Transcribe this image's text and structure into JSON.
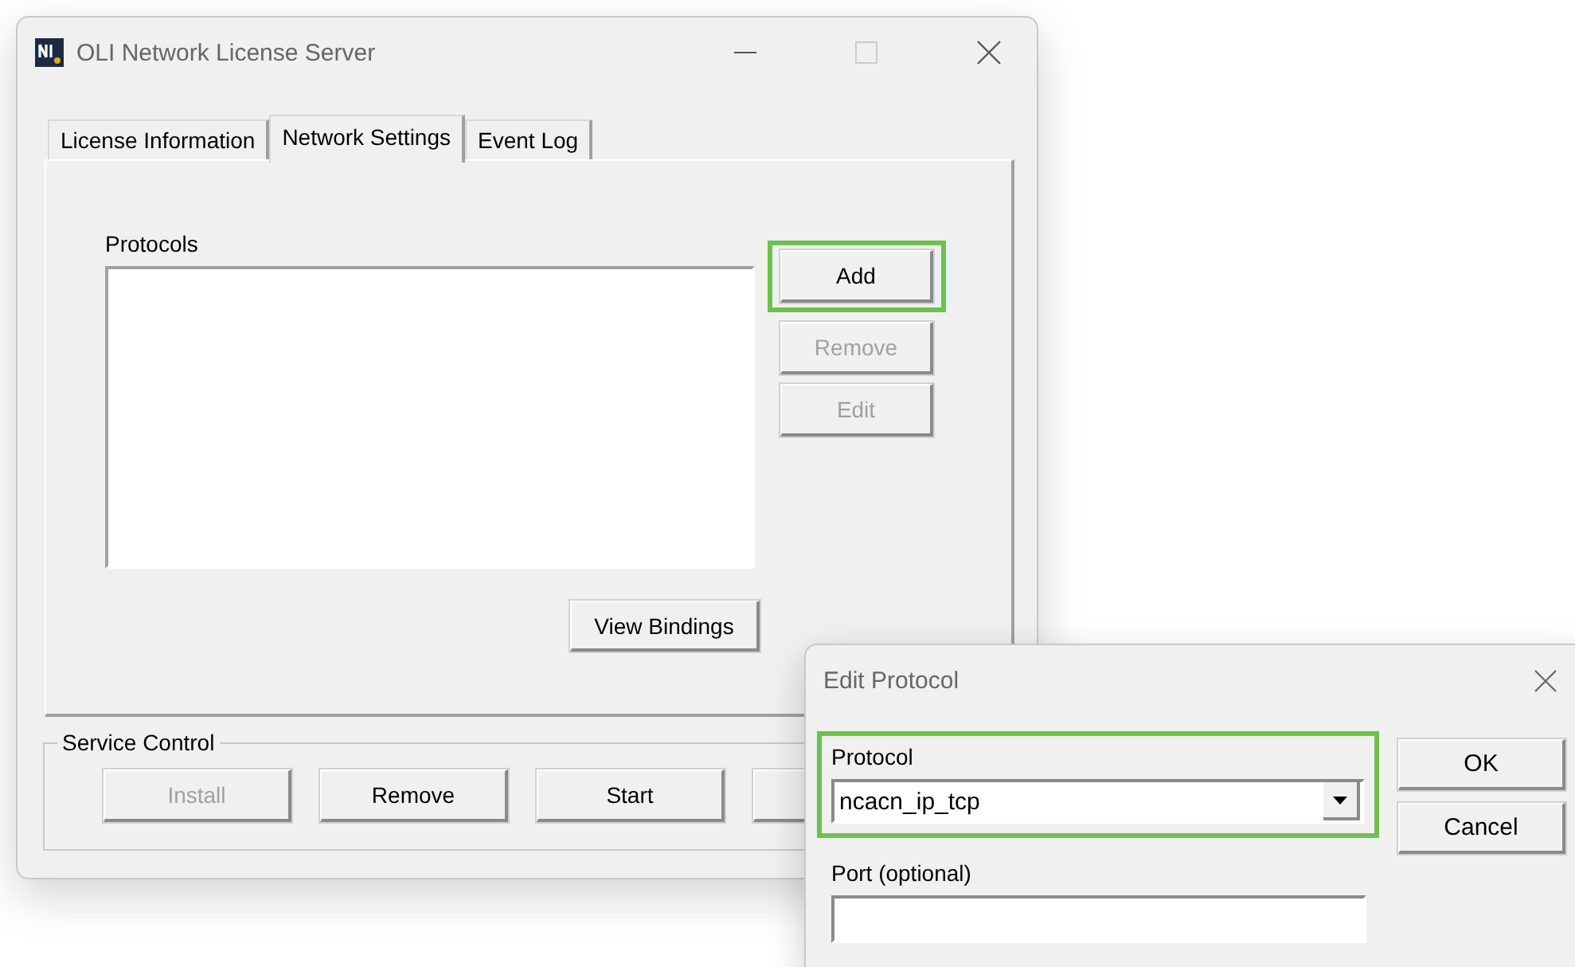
{
  "window": {
    "title": "OLI Network License Server"
  },
  "tabs": [
    {
      "label": "License Information",
      "selected": false
    },
    {
      "label": "Network Settings",
      "selected": true
    },
    {
      "label": "Event Log",
      "selected": false
    }
  ],
  "protocols": {
    "label": "Protocols"
  },
  "side_buttons": [
    {
      "label": "Add",
      "disabled": false,
      "highlighted": true
    },
    {
      "label": "Remove",
      "disabled": true,
      "highlighted": false
    },
    {
      "label": "Edit",
      "disabled": true,
      "highlighted": false
    }
  ],
  "view_bindings": {
    "label": "View Bindings"
  },
  "service_control": {
    "label": "Service Control",
    "buttons": [
      {
        "label": "Install",
        "disabled": true
      },
      {
        "label": "Remove",
        "disabled": false
      },
      {
        "label": "Start",
        "disabled": false
      }
    ]
  },
  "dialog": {
    "title": "Edit Protocol",
    "protocol": {
      "label": "Protocol",
      "value": "ncacn_ip_tcp",
      "highlighted": true
    },
    "port": {
      "label": "Port  (optional)"
    },
    "buttons": [
      "OK",
      "Cancel"
    ]
  }
}
